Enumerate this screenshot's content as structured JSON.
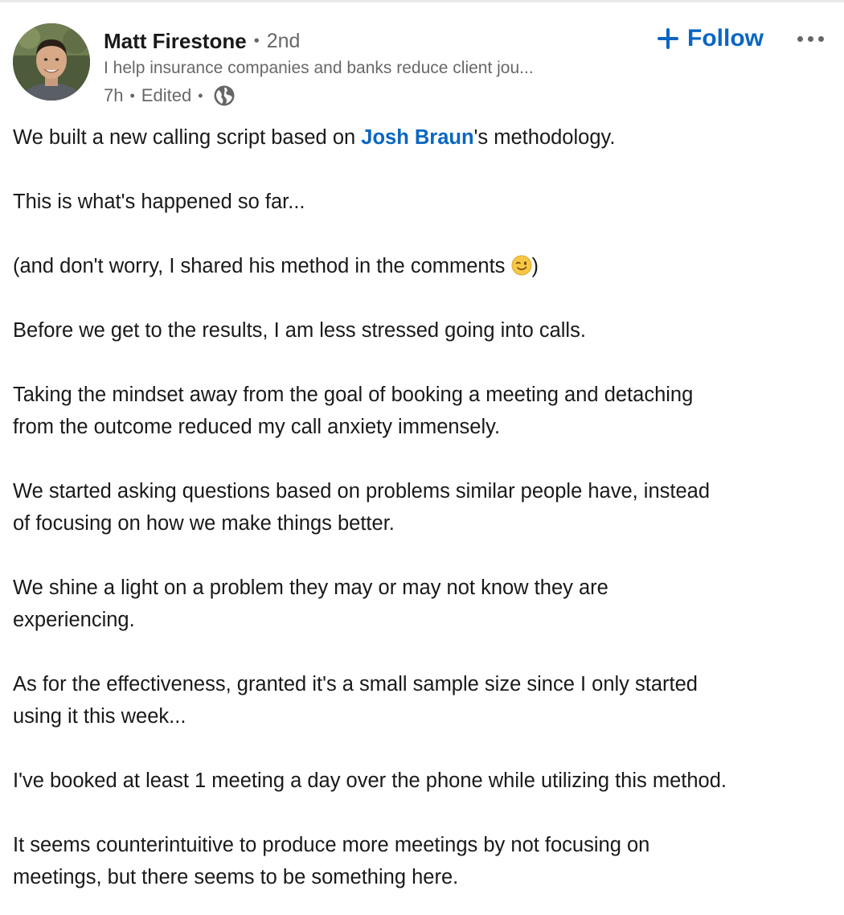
{
  "actor": {
    "name": "Matt Firestone",
    "degree": "2nd",
    "headline": "I help insurance companies and banks reduce client jou...",
    "time": "7h",
    "edited": "Edited",
    "separator": "•",
    "visibility_icon": "globe-icon",
    "avatar_icon": "profile-photo"
  },
  "actions": {
    "follow_label": "Follow",
    "follow_icon": "plus-icon",
    "more_icon": "ellipsis-icon"
  },
  "post": {
    "line1_before": "We built a new calling script based on ",
    "line1_mention": "Josh Braun",
    "line1_after": "'s methodology.",
    "p2": "This is what's happened so far...",
    "p3_text": "(and don't worry, I shared his method in the comments ",
    "p3_emoji": "winking-face-emoji",
    "p3_close": ")",
    "p4": "Before we get to the results, I am less stressed going into calls.",
    "p5_line1": "Taking the mindset away from the goal of booking a meeting and detaching",
    "p5_line2": "from the outcome reduced my call anxiety immensely.",
    "p6_line1": "We started asking questions based on problems similar people have, instead",
    "p6_line2": "of focusing on how we make things better.",
    "p7_line1": "We shine a light on a problem they may or may not know they are",
    "p7_line2": "experiencing.",
    "p8_line1": "As for the effectiveness, granted it's a small sample size since I only started",
    "p8_line2": "using it this week...",
    "p9": "I've booked at least 1 meeting a day over the phone while utilizing this method.",
    "p10_line1": "It seems counterintuitive to produce more meetings by not focusing on",
    "p10_line2": "meetings, but there seems to be something here."
  },
  "colors": {
    "link": "#0a66c2",
    "text": "#000000e6",
    "secondary_text": "#00000099"
  }
}
